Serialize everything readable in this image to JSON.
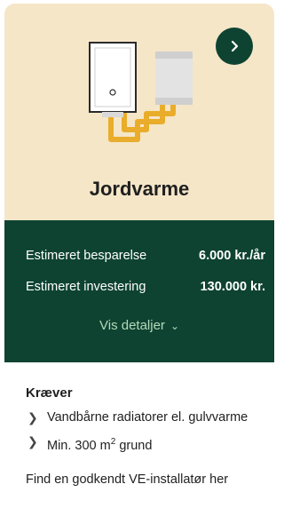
{
  "card": {
    "title": "Jordvarme",
    "next_icon": "chevron-right-icon",
    "illustration_icon": "ground-source-heat-pump-illustration"
  },
  "stats": {
    "rows": [
      {
        "label": "Estimeret besparelse",
        "value": "6.000 kr./år"
      },
      {
        "label": "Estimeret investering",
        "value": "130.000 kr."
      }
    ],
    "details_label": "Vis detaljer",
    "details_icon": "chevron-down-icon"
  },
  "requirements": {
    "title": "Kræver",
    "item_icon": "chevron-right-icon",
    "items": [
      {
        "text": "Vandbårne radiatorer el. gulvvarme"
      },
      {
        "text_before": "Min. 300 m",
        "sup": "2",
        "text_after": " grund"
      }
    ],
    "installer_link": "Find en godkendt VE-installatør her"
  },
  "colors": {
    "hero_bg": "#f5e6c8",
    "dark_green": "#0e4332",
    "link_green": "#b4d9b7",
    "pipe_orange": "#e9ad2b"
  }
}
